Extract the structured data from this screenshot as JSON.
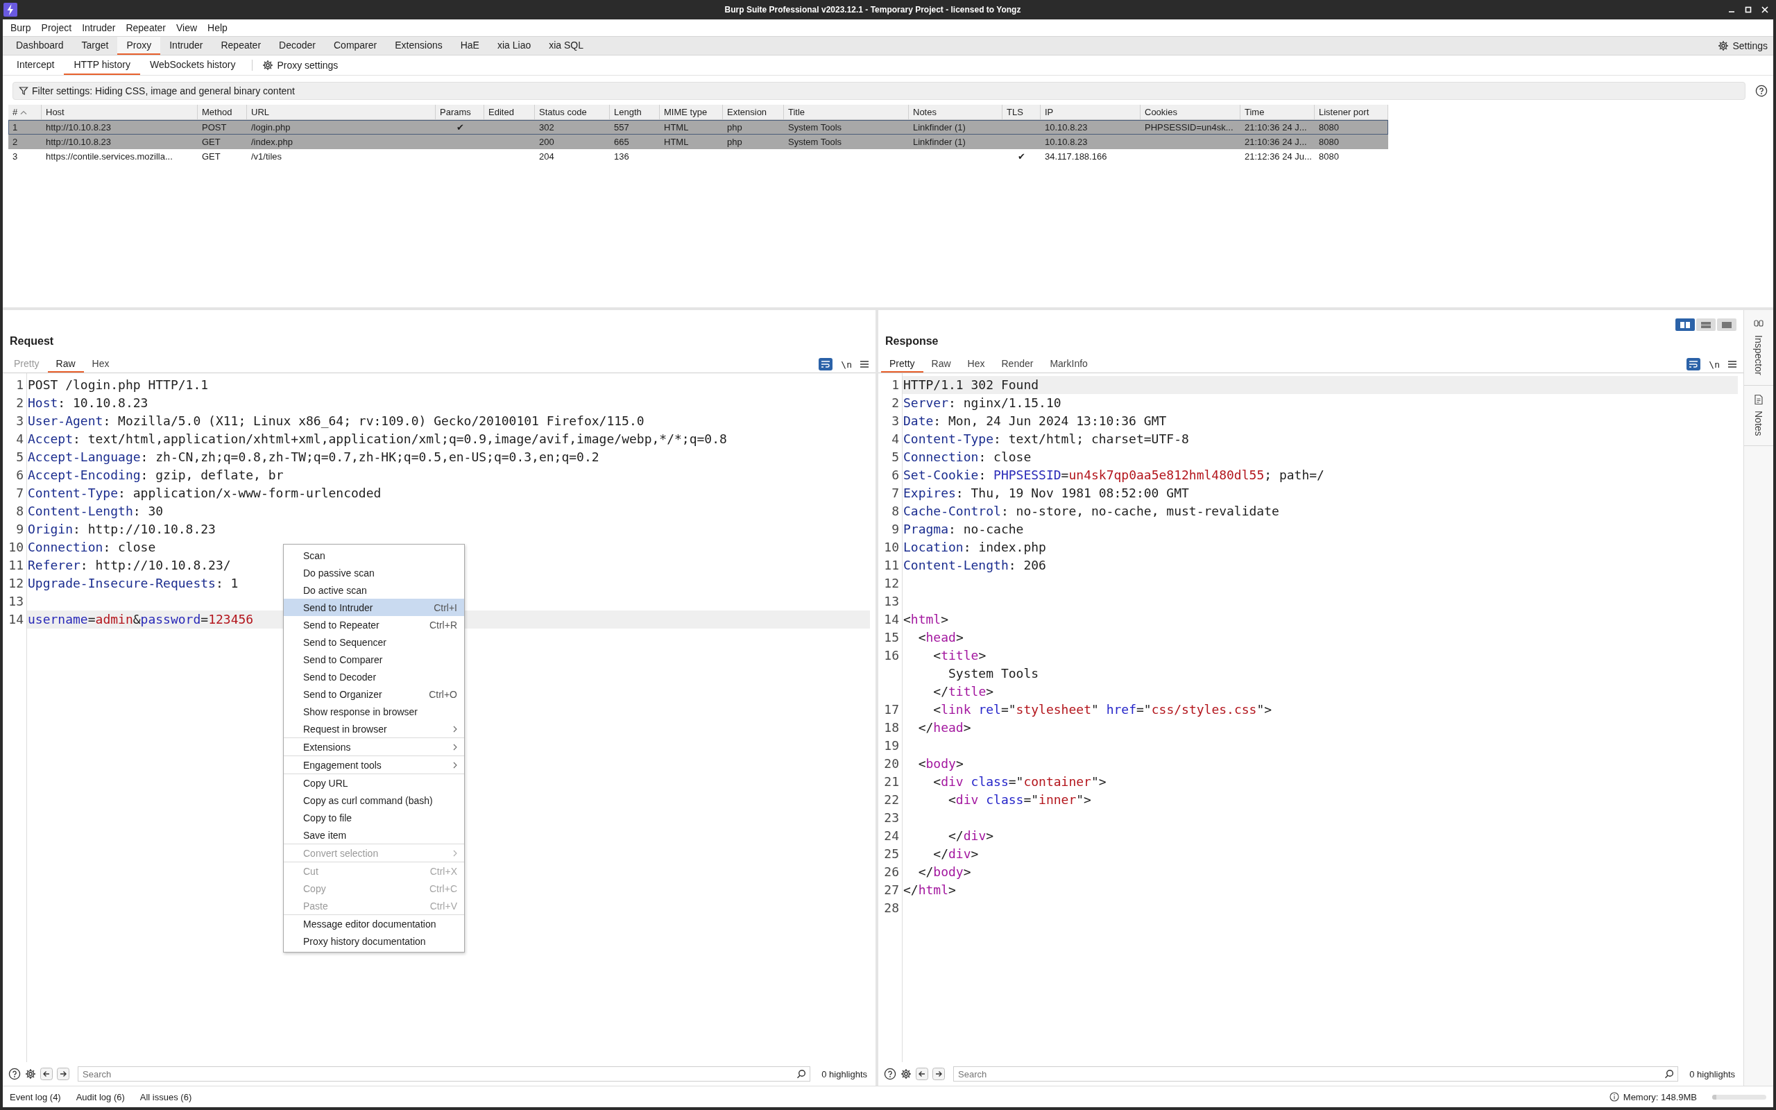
{
  "window": {
    "title": "Burp Suite Professional v2023.12.1 - Temporary Project - licensed to Yongz"
  },
  "menu_bar": [
    "Burp",
    "Project",
    "Intruder",
    "Repeater",
    "View",
    "Help"
  ],
  "main_tabs": [
    {
      "label": "Dashboard",
      "selected": false
    },
    {
      "label": "Target",
      "selected": false
    },
    {
      "label": "Proxy",
      "selected": true
    },
    {
      "label": "Intruder",
      "selected": false
    },
    {
      "label": "Repeater",
      "selected": false
    },
    {
      "label": "Decoder",
      "selected": false
    },
    {
      "label": "Comparer",
      "selected": false
    },
    {
      "label": "Extensions",
      "selected": false
    },
    {
      "label": "HaE",
      "selected": false
    },
    {
      "label": "xia Liao",
      "selected": false
    },
    {
      "label": "xia SQL",
      "selected": false
    }
  ],
  "settings_button": "Settings",
  "proxy_tabs": [
    {
      "label": "Intercept",
      "selected": false
    },
    {
      "label": "HTTP history",
      "selected": true
    },
    {
      "label": "WebSockets history",
      "selected": false
    }
  ],
  "proxy_settings_button": "Proxy settings",
  "filter_bar": "Filter settings: Hiding CSS, image and general binary content",
  "history_table": {
    "columns": [
      "#",
      "Host",
      "Method",
      "URL",
      "Params",
      "Edited",
      "Status code",
      "Length",
      "MIME type",
      "Extension",
      "Title",
      "Notes",
      "TLS",
      "IP",
      "Cookies",
      "Time",
      "Listener port"
    ],
    "rows": [
      {
        "selected": true,
        "cells": {
          "num": "1",
          "host": "http://10.10.8.23",
          "method": "POST",
          "url": "/login.php",
          "params": "✔",
          "status_code": "302",
          "length": "557",
          "mime_type": "HTML",
          "extension": "php",
          "title": "System Tools",
          "notes": "Linkfinder (1)",
          "ip": "10.10.8.23",
          "cookies": "PHPSESSID=un4sk...",
          "time": "21:10:36 24 J...",
          "listener_port": "8080"
        }
      },
      {
        "selected": true,
        "cells": {
          "num": "2",
          "host": "http://10.10.8.23",
          "method": "GET",
          "url": "/index.php",
          "status_code": "200",
          "length": "665",
          "mime_type": "HTML",
          "extension": "php",
          "title": "System Tools",
          "notes": "Linkfinder (1)",
          "ip": "10.10.8.23",
          "time": "21:10:36 24 J...",
          "listener_port": "8080"
        }
      },
      {
        "selected": false,
        "cells": {
          "num": "3",
          "host": "https://contile.services.mozilla...",
          "method": "GET",
          "url": "/v1/tiles",
          "status_code": "204",
          "length": "136",
          "tls": "✔",
          "ip": "34.117.188.166",
          "time": "21:12:36 24 Ju...",
          "listener_port": "8080"
        }
      }
    ]
  },
  "request": {
    "title": "Request",
    "tabs": [
      {
        "label": "Pretty",
        "selected": false,
        "disabled": true
      },
      {
        "label": "Raw",
        "selected": true,
        "disabled": false
      },
      {
        "label": "Hex",
        "selected": false,
        "disabled": false
      }
    ],
    "wrap_on": true,
    "newline_toggle": "\\n",
    "lines": [
      {
        "n": "1",
        "current": false,
        "segs": [
          {
            "kind": "plain",
            "text": "POST /login.php HTTP/1.1"
          }
        ]
      },
      {
        "n": "2",
        "current": false,
        "segs": [
          {
            "kind": "name",
            "text": "Host"
          },
          {
            "kind": "plain",
            "text": ": 10.10.8.23"
          }
        ]
      },
      {
        "n": "3",
        "current": false,
        "segs": [
          {
            "kind": "name",
            "text": "User-Agent"
          },
          {
            "kind": "plain",
            "text": ": Mozilla/5.0 (X11; Linux x86_64; rv:109.0) Gecko/20100101 Firefox/115.0"
          }
        ]
      },
      {
        "n": "4",
        "current": false,
        "segs": [
          {
            "kind": "name",
            "text": "Accept"
          },
          {
            "kind": "plain",
            "text": ": text/html,application/xhtml+xml,application/xml;q=0.9,image/avif,image/webp,*/*;q=0.8"
          }
        ]
      },
      {
        "n": "5",
        "current": false,
        "segs": [
          {
            "kind": "name",
            "text": "Accept-Language"
          },
          {
            "kind": "plain",
            "text": ": zh-CN,zh;q=0.8,zh-TW;q=0.7,zh-HK;q=0.5,en-US;q=0.3,en;q=0.2"
          }
        ]
      },
      {
        "n": "6",
        "current": false,
        "segs": [
          {
            "kind": "name",
            "text": "Accept-Encoding"
          },
          {
            "kind": "plain",
            "text": ": gzip, deflate, br"
          }
        ]
      },
      {
        "n": "7",
        "current": false,
        "segs": [
          {
            "kind": "name",
            "text": "Content-Type"
          },
          {
            "kind": "plain",
            "text": ": application/x-www-form-urlencoded"
          }
        ]
      },
      {
        "n": "8",
        "current": false,
        "segs": [
          {
            "kind": "name",
            "text": "Content-Length"
          },
          {
            "kind": "plain",
            "text": ": 30"
          }
        ]
      },
      {
        "n": "9",
        "current": false,
        "segs": [
          {
            "kind": "name",
            "text": "Origin"
          },
          {
            "kind": "plain",
            "text": ": http://10.10.8.23"
          }
        ]
      },
      {
        "n": "10",
        "current": false,
        "segs": [
          {
            "kind": "name",
            "text": "Connection"
          },
          {
            "kind": "plain",
            "text": ": close"
          }
        ]
      },
      {
        "n": "11",
        "current": false,
        "segs": [
          {
            "kind": "name",
            "text": "Referer"
          },
          {
            "kind": "plain",
            "text": ": http://10.10.8.23/"
          }
        ]
      },
      {
        "n": "12",
        "current": false,
        "segs": [
          {
            "kind": "name",
            "text": "Upgrade-Insecure-Requests"
          },
          {
            "kind": "plain",
            "text": ": 1"
          }
        ]
      },
      {
        "n": "13",
        "current": false
      },
      {
        "n": "14",
        "current": true,
        "segs": [
          {
            "kind": "param",
            "text": "username"
          },
          {
            "kind": "plain",
            "text": "="
          },
          {
            "kind": "value",
            "text": "admin"
          },
          {
            "kind": "plain",
            "text": "&"
          },
          {
            "kind": "param",
            "text": "password"
          },
          {
            "kind": "plain",
            "text": "="
          },
          {
            "kind": "value",
            "text": "123456"
          }
        ]
      }
    ],
    "search": {
      "placeholder": "Search"
    },
    "highlights": "0 highlights"
  },
  "response": {
    "title": "Response",
    "layout_buttons": [
      {
        "selected": true
      },
      {
        "selected": false
      },
      {
        "selected": false
      }
    ],
    "tabs": [
      {
        "label": "Pretty",
        "selected": true
      },
      {
        "label": "Raw",
        "selected": false
      },
      {
        "label": "Hex",
        "selected": false
      },
      {
        "label": "Render",
        "selected": false
      },
      {
        "label": "MarkInfo",
        "selected": false
      }
    ],
    "wrap_on": true,
    "newline_toggle": "\\n",
    "lines": [
      {
        "n": "1",
        "current": true,
        "segs": [
          {
            "kind": "plain",
            "text": "HTTP/1.1 302 Found"
          }
        ]
      },
      {
        "n": "2",
        "current": false,
        "segs": [
          {
            "kind": "name",
            "text": "Server"
          },
          {
            "kind": "plain",
            "text": ": nginx/1.15.10"
          }
        ]
      },
      {
        "n": "3",
        "current": false,
        "segs": [
          {
            "kind": "name",
            "text": "Date"
          },
          {
            "kind": "plain",
            "text": ": Mon, 24 Jun 2024 13:10:36 GMT"
          }
        ]
      },
      {
        "n": "4",
        "current": false,
        "segs": [
          {
            "kind": "name",
            "text": "Content-Type"
          },
          {
            "kind": "plain",
            "text": ": text/html; charset=UTF-8"
          }
        ]
      },
      {
        "n": "5",
        "current": false,
        "segs": [
          {
            "kind": "name",
            "text": "Connection"
          },
          {
            "kind": "plain",
            "text": ": close"
          }
        ]
      },
      {
        "n": "6",
        "current": false,
        "segs": [
          {
            "kind": "name",
            "text": "Set-Cookie"
          },
          {
            "kind": "plain",
            "text": ": "
          },
          {
            "kind": "param",
            "text": "PHPSESSID"
          },
          {
            "kind": "plain",
            "text": "="
          },
          {
            "kind": "value",
            "text": "un4sk7qp0aa5e812hml480dl55"
          },
          {
            "kind": "plain",
            "text": "; path=/"
          }
        ]
      },
      {
        "n": "7",
        "current": false,
        "segs": [
          {
            "kind": "name",
            "text": "Expires"
          },
          {
            "kind": "plain",
            "text": ": Thu, 19 Nov 1981 08:52:00 GMT"
          }
        ]
      },
      {
        "n": "8",
        "current": false,
        "segs": [
          {
            "kind": "name",
            "text": "Cache-Control"
          },
          {
            "kind": "plain",
            "text": ": no-store, no-cache, must-revalidate"
          }
        ]
      },
      {
        "n": "9",
        "current": false,
        "segs": [
          {
            "kind": "name",
            "text": "Pragma"
          },
          {
            "kind": "plain",
            "text": ": no-cache"
          }
        ]
      },
      {
        "n": "10",
        "current": false,
        "segs": [
          {
            "kind": "name",
            "text": "Location"
          },
          {
            "kind": "plain",
            "text": ": index.php"
          }
        ]
      },
      {
        "n": "11",
        "current": false,
        "segs": [
          {
            "kind": "name",
            "text": "Content-Length"
          },
          {
            "kind": "plain",
            "text": ": 206"
          }
        ]
      },
      {
        "n": "12",
        "current": false
      },
      {
        "n": "13",
        "current": false
      },
      {
        "n": "14",
        "current": false,
        "segs": [
          {
            "kind": "plain",
            "text": "<"
          },
          {
            "kind": "tag",
            "text": "html"
          },
          {
            "kind": "plain",
            "text": ">"
          }
        ]
      },
      {
        "n": "15",
        "current": false,
        "segs": [
          {
            "kind": "plain",
            "text": "  <"
          },
          {
            "kind": "tag",
            "text": "head"
          },
          {
            "kind": "plain",
            "text": ">"
          }
        ]
      },
      {
        "n": "16",
        "current": false,
        "segs": [
          {
            "kind": "plain",
            "text": "    <"
          },
          {
            "kind": "tag",
            "text": "title"
          },
          {
            "kind": "plain",
            "text": ">"
          }
        ]
      },
      {
        "current": false,
        "segs": [
          {
            "kind": "plain",
            "text": "      System Tools"
          }
        ]
      },
      {
        "current": false,
        "segs": [
          {
            "kind": "plain",
            "text": "    </"
          },
          {
            "kind": "tag",
            "text": "title"
          },
          {
            "kind": "plain",
            "text": ">"
          }
        ]
      },
      {
        "n": "17",
        "current": false,
        "segs": [
          {
            "kind": "plain",
            "text": "    <"
          },
          {
            "kind": "tag",
            "text": "link"
          },
          {
            "kind": "attr",
            "text": " rel"
          },
          {
            "kind": "plain",
            "text": "=\""
          },
          {
            "kind": "value",
            "text": "stylesheet"
          },
          {
            "kind": "plain",
            "text": "\" "
          },
          {
            "kind": "attr",
            "text": "href"
          },
          {
            "kind": "plain",
            "text": "=\""
          },
          {
            "kind": "value",
            "text": "css/styles.css"
          },
          {
            "kind": "plain",
            "text": "\">"
          }
        ]
      },
      {
        "n": "18",
        "current": false,
        "segs": [
          {
            "kind": "plain",
            "text": "  </"
          },
          {
            "kind": "tag",
            "text": "head"
          },
          {
            "kind": "plain",
            "text": ">"
          }
        ]
      },
      {
        "n": "19",
        "current": false
      },
      {
        "n": "20",
        "current": false,
        "segs": [
          {
            "kind": "plain",
            "text": "  <"
          },
          {
            "kind": "tag",
            "text": "body"
          },
          {
            "kind": "plain",
            "text": ">"
          }
        ]
      },
      {
        "n": "21",
        "current": false,
        "segs": [
          {
            "kind": "plain",
            "text": "    <"
          },
          {
            "kind": "tag",
            "text": "div"
          },
          {
            "kind": "attr",
            "text": " class"
          },
          {
            "kind": "plain",
            "text": "=\""
          },
          {
            "kind": "value",
            "text": "container"
          },
          {
            "kind": "plain",
            "text": "\">"
          }
        ]
      },
      {
        "n": "22",
        "current": false,
        "segs": [
          {
            "kind": "plain",
            "text": "      <"
          },
          {
            "kind": "tag",
            "text": "div"
          },
          {
            "kind": "attr",
            "text": " class"
          },
          {
            "kind": "plain",
            "text": "=\""
          },
          {
            "kind": "value",
            "text": "inner"
          },
          {
            "kind": "plain",
            "text": "\">"
          }
        ]
      },
      {
        "n": "23",
        "current": false
      },
      {
        "n": "24",
        "current": false,
        "segs": [
          {
            "kind": "plain",
            "text": "      </"
          },
          {
            "kind": "tag",
            "text": "div"
          },
          {
            "kind": "plain",
            "text": ">"
          }
        ]
      },
      {
        "n": "25",
        "current": false,
        "segs": [
          {
            "kind": "plain",
            "text": "    </"
          },
          {
            "kind": "tag",
            "text": "div"
          },
          {
            "kind": "plain",
            "text": ">"
          }
        ]
      },
      {
        "n": "26",
        "current": false,
        "segs": [
          {
            "kind": "plain",
            "text": "  </"
          },
          {
            "kind": "tag",
            "text": "body"
          },
          {
            "kind": "plain",
            "text": ">"
          }
        ]
      },
      {
        "n": "27",
        "current": false,
        "segs": [
          {
            "kind": "plain",
            "text": "</"
          },
          {
            "kind": "tag",
            "text": "html"
          },
          {
            "kind": "plain",
            "text": ">"
          }
        ]
      },
      {
        "n": "28",
        "current": false
      }
    ],
    "search": {
      "placeholder": "Search"
    },
    "highlights": "0 highlights"
  },
  "side_panel": [
    {
      "kind": "inspector",
      "label": "Inspector"
    },
    {
      "kind": "notes",
      "label": "Notes"
    }
  ],
  "context_menu": {
    "groups": [
      [
        {
          "label": "Scan",
          "selected": false,
          "disabled": false,
          "submenu": false
        },
        {
          "label": "Do passive scan",
          "selected": false,
          "disabled": false,
          "submenu": false
        },
        {
          "label": "Do active scan",
          "selected": false,
          "disabled": false,
          "submenu": false
        },
        {
          "label": "Send to Intruder",
          "shortcut": "Ctrl+I",
          "selected": true,
          "disabled": false,
          "submenu": false
        },
        {
          "label": "Send to Repeater",
          "shortcut": "Ctrl+R",
          "selected": false,
          "disabled": false,
          "submenu": false
        },
        {
          "label": "Send to Sequencer",
          "selected": false,
          "disabled": false,
          "submenu": false
        },
        {
          "label": "Send to Comparer",
          "selected": false,
          "disabled": false,
          "submenu": false
        },
        {
          "label": "Send to Decoder",
          "selected": false,
          "disabled": false,
          "submenu": false
        },
        {
          "label": "Send to Organizer",
          "shortcut": "Ctrl+O",
          "selected": false,
          "disabled": false,
          "submenu": false
        },
        {
          "label": "Show response in browser",
          "selected": false,
          "disabled": false,
          "submenu": false
        },
        {
          "label": "Request in browser",
          "selected": false,
          "disabled": false,
          "submenu": true
        }
      ],
      [
        {
          "label": "Extensions",
          "selected": false,
          "disabled": false,
          "submenu": true
        }
      ],
      [
        {
          "label": "Engagement tools",
          "selected": false,
          "disabled": false,
          "submenu": true
        }
      ],
      [
        {
          "label": "Copy URL",
          "selected": false,
          "disabled": false,
          "submenu": false
        },
        {
          "label": "Copy as curl command (bash)",
          "selected": false,
          "disabled": false,
          "submenu": false
        },
        {
          "label": "Copy to file",
          "selected": false,
          "disabled": false,
          "submenu": false
        },
        {
          "label": "Save item",
          "selected": false,
          "disabled": false,
          "submenu": false
        }
      ],
      [
        {
          "label": "Convert selection",
          "selected": false,
          "disabled": true,
          "submenu": true
        }
      ],
      [
        {
          "label": "Cut",
          "shortcut": "Ctrl+X",
          "selected": false,
          "disabled": true,
          "submenu": false
        },
        {
          "label": "Copy",
          "shortcut": "Ctrl+C",
          "selected": false,
          "disabled": true,
          "submenu": false
        },
        {
          "label": "Paste",
          "shortcut": "Ctrl+V",
          "selected": false,
          "disabled": true,
          "submenu": false
        }
      ],
      [
        {
          "label": "Message editor documentation",
          "selected": false,
          "disabled": false,
          "submenu": false
        },
        {
          "label": "Proxy history documentation",
          "selected": false,
          "disabled": false,
          "submenu": false
        }
      ]
    ]
  },
  "status_bar": {
    "items": [
      "Event log (4)",
      "Audit log (6)",
      "All issues (6)"
    ],
    "memory": "Memory: 148.9MB",
    "memory_bar": {
      "level": 0.08
    }
  }
}
